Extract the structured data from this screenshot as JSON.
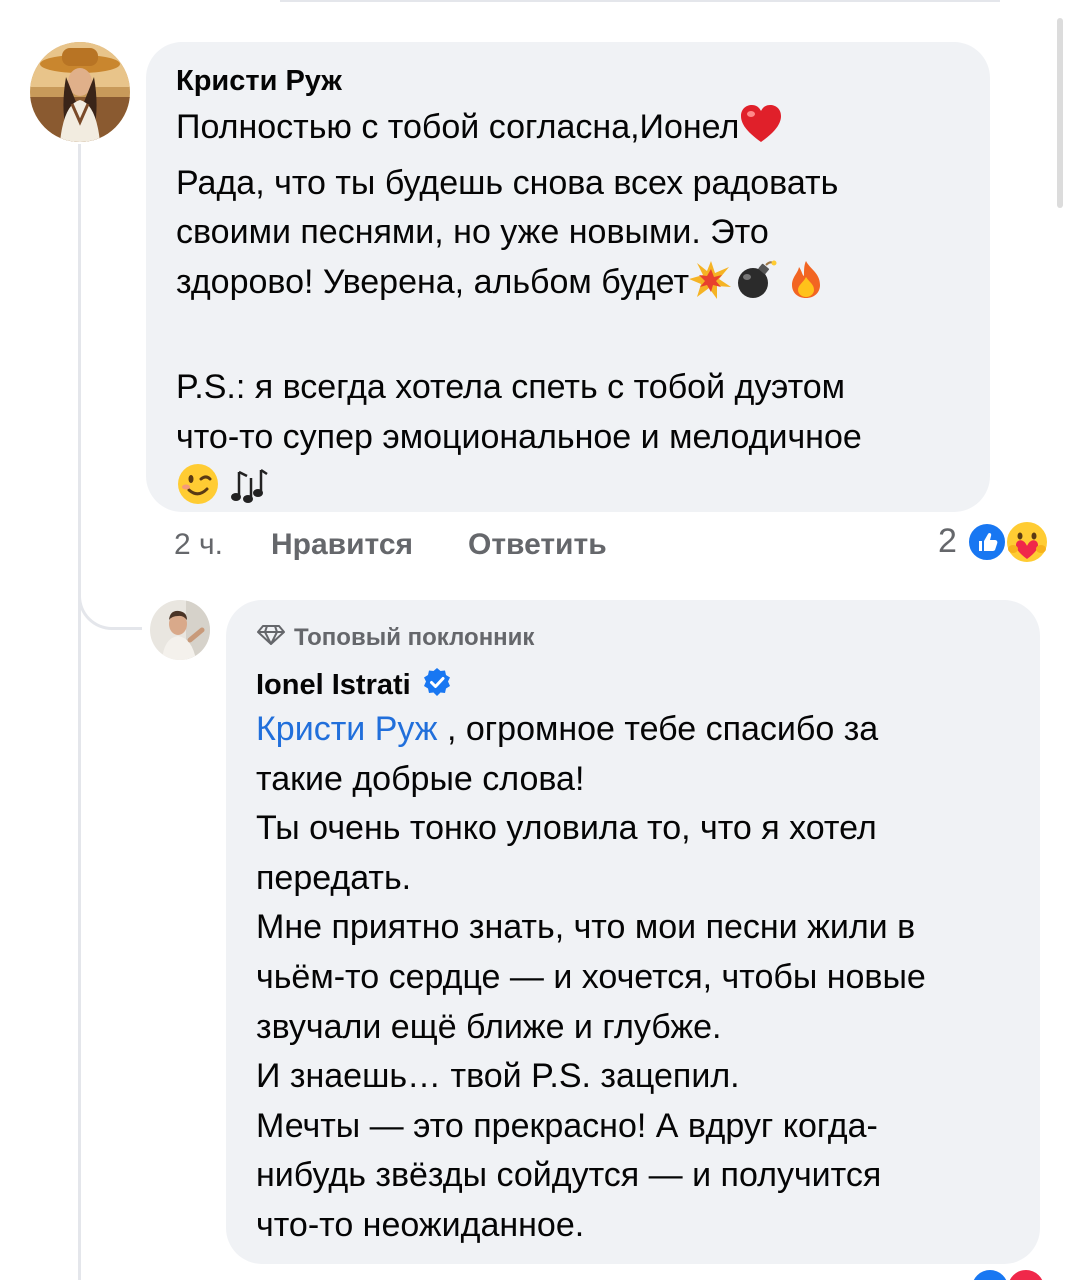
{
  "comment1": {
    "author": "Кристи Руж",
    "lines": [
      "Полностью с тобой согласна,Ионел",
      "Рада, что ты будешь снова всех радовать",
      "своими песнями, но уже новыми. Это",
      "здорово! Уверена, альбом будет",
      "",
      "P.S.: я всегда хотела спеть с тобой дуэтом",
      "что-то супер эмоциональное и мелодичное"
    ],
    "time": "2 ч.",
    "like_label": "Нравится",
    "reply_label": "Ответить",
    "reaction_count": "2"
  },
  "comment2": {
    "badge": "Топовый поклонник",
    "author": "Ionel Istrati",
    "mention": "Кристи Руж",
    "first_line_rest": " , огромное тебе спасибо за",
    "lines": [
      "такие добрые слова!",
      "Ты очень тонко уловила то, что я хотел",
      "передать.",
      "Мне приятно знать, что мои песни жили в",
      "чьём-то сердце — и хочется, чтобы новые",
      "звучали ещё ближе и глубже.",
      "И знаешь… твой P.S. зацепил.",
      "Мечты — это прекрасно! А вдруг когда-",
      "нибудь звёзды сойдутся — и получится",
      "что-то неожиданное."
    ]
  },
  "colors": {
    "bubble": "#f0f2f5",
    "meta_text": "#65676b",
    "mention": "#216fdb",
    "verified": "#1877f2",
    "thread_line": "#e4e6eb"
  },
  "icons": [
    "red-heart-emoji",
    "collision-emoji",
    "bomb-emoji",
    "fire-emoji",
    "winking-face-emoji",
    "musical-notes-emoji",
    "like-reaction-icon",
    "care-reaction-icon",
    "diamond-icon",
    "verified-badge-icon"
  ]
}
